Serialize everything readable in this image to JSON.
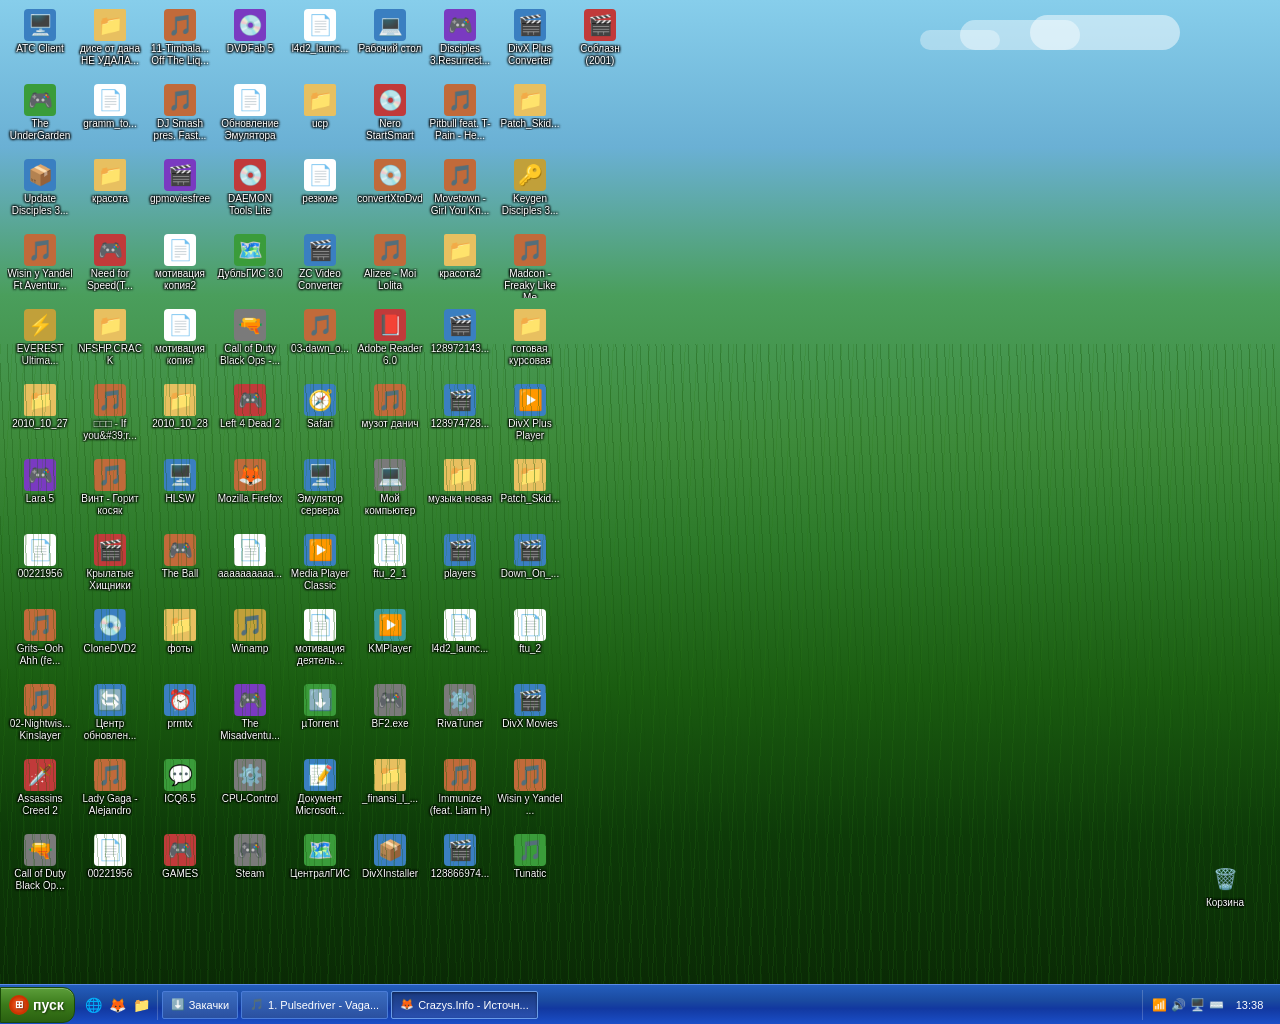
{
  "desktop": {
    "icons": [
      {
        "id": "atc-client",
        "label": "ATC Client",
        "emoji": "🖥️",
        "color": "ic-blue"
      },
      {
        "id": "undergarden",
        "label": "The UnderGarden",
        "emoji": "🎮",
        "color": "ic-green"
      },
      {
        "id": "update-disciples",
        "label": "Update Disciples 3...",
        "emoji": "📦",
        "color": "ic-blue"
      },
      {
        "id": "wisin-yandel",
        "label": "Wisin y Yandel Ft Aventur...",
        "emoji": "🎵",
        "color": "ic-orange"
      },
      {
        "id": "everest",
        "label": "EVEREST Ultima...",
        "emoji": "⚡",
        "color": "ic-yellow"
      },
      {
        "id": "2010-10-27",
        "label": "2010_10_27",
        "emoji": "📁",
        "color": "ic-folder"
      },
      {
        "id": "lara5",
        "label": "Lara 5",
        "emoji": "🎮",
        "color": "ic-purple"
      },
      {
        "id": "00221956-1",
        "label": "00221956",
        "emoji": "📄",
        "color": "ic-white"
      },
      {
        "id": "grits",
        "label": "Grits--Ooh Ahh (fe...",
        "emoji": "🎵",
        "color": "ic-orange"
      },
      {
        "id": "02-nightwish",
        "label": "02-Nightwis... Kinslayer",
        "emoji": "🎵",
        "color": "ic-orange"
      },
      {
        "id": "assassins-creed",
        "label": "Assassins Creed 2",
        "emoji": "🗡️",
        "color": "ic-red"
      },
      {
        "id": "call-of-duty-1",
        "label": "Call of Duty Black Op...",
        "emoji": "🔫",
        "color": "ic-gray"
      },
      {
        "id": "dise-ot-dana",
        "label": "дисе от дана НЕ УДАЛА...",
        "emoji": "📁",
        "color": "ic-folder"
      },
      {
        "id": "gramm-to",
        "label": "gramm_to...",
        "emoji": "📄",
        "color": "ic-white"
      },
      {
        "id": "krasota1",
        "label": "красота",
        "emoji": "📁",
        "color": "ic-folder"
      },
      {
        "id": "need-for-speed",
        "label": "Need for Speed(T...",
        "emoji": "🎮",
        "color": "ic-red"
      },
      {
        "id": "nfshp-crack",
        "label": "NFSHP.CRACK",
        "emoji": "📁",
        "color": "ic-folder"
      },
      {
        "id": "square-you",
        "label": "□□□ - If you&#39;r...",
        "emoji": "🎵",
        "color": "ic-orange"
      },
      {
        "id": "vint",
        "label": "Винт - Горит косяк",
        "emoji": "🎵",
        "color": "ic-orange"
      },
      {
        "id": "krylatye",
        "label": "Крылатые Хищники",
        "emoji": "🎬",
        "color": "ic-red"
      },
      {
        "id": "clonedvd2",
        "label": "CloneDVD2",
        "emoji": "💿",
        "color": "ic-blue"
      },
      {
        "id": "centr-obnovl",
        "label": "Центр обновлен...",
        "emoji": "🔄",
        "color": "ic-blue"
      },
      {
        "id": "lady-gaga",
        "label": "Lady Gaga - Alejandro",
        "emoji": "🎵",
        "color": "ic-orange"
      },
      {
        "id": "00221956-2",
        "label": "00221956",
        "emoji": "📄",
        "color": "ic-white"
      },
      {
        "id": "11-timbalake",
        "label": "11-Timbala... Off The Liq...",
        "emoji": "🎵",
        "color": "ic-orange"
      },
      {
        "id": "dj-smash",
        "label": "DJ Smash pres. Fast...",
        "emoji": "🎵",
        "color": "ic-orange"
      },
      {
        "id": "gpmoviesfree",
        "label": "gpmoviesfree",
        "emoji": "🎬",
        "color": "ic-purple"
      },
      {
        "id": "motivatsiya-kopia2",
        "label": "мотивация копия2",
        "emoji": "📄",
        "color": "ic-white"
      },
      {
        "id": "motivatsiya-kopia",
        "label": "мотивация копия",
        "emoji": "📄",
        "color": "ic-white"
      },
      {
        "id": "2010-10-27b",
        "label": "2010_10_28",
        "emoji": "📁",
        "color": "ic-folder"
      },
      {
        "id": "hlsw",
        "label": "HLSW",
        "emoji": "🖥️",
        "color": "ic-blue"
      },
      {
        "id": "the-ball",
        "label": "The Ball",
        "emoji": "🎮",
        "color": "ic-orange"
      },
      {
        "id": "foty",
        "label": "фоты",
        "emoji": "📁",
        "color": "ic-folder"
      },
      {
        "id": "prmtx",
        "label": "prmtx",
        "emoji": "⏰",
        "color": "ic-blue"
      },
      {
        "id": "icq65",
        "label": "ICQ6.5",
        "emoji": "💬",
        "color": "ic-green"
      },
      {
        "id": "games",
        "label": "GAMES",
        "emoji": "🎮",
        "color": "ic-red"
      },
      {
        "id": "dvdfab5",
        "label": "DVDFab 5",
        "emoji": "💿",
        "color": "ic-purple"
      },
      {
        "id": "obnovlenie",
        "label": "Обновление Эмулятора",
        "emoji": "📄",
        "color": "ic-white"
      },
      {
        "id": "daemon-tools",
        "label": "DAEMON Tools Lite",
        "emoji": "💿",
        "color": "ic-red"
      },
      {
        "id": "dubIgis",
        "label": "ДубльГИС 3.0",
        "emoji": "🗺️",
        "color": "ic-green"
      },
      {
        "id": "call-of-duty-2",
        "label": "Call of Duty Black Ops -...",
        "emoji": "🔫",
        "color": "ic-gray"
      },
      {
        "id": "left4dead2",
        "label": "Left 4 Dead 2",
        "emoji": "🎮",
        "color": "ic-red"
      },
      {
        "id": "mozilla-firefox",
        "label": "Mozilla Firefox",
        "emoji": "🦊",
        "color": "ic-orange"
      },
      {
        "id": "aaaaa",
        "label": "аааааааааа...",
        "emoji": "📄",
        "color": "ic-white"
      },
      {
        "id": "winamp",
        "label": "Winamp",
        "emoji": "🎵",
        "color": "ic-yellow"
      },
      {
        "id": "misadventu",
        "label": "The Misadventu...",
        "emoji": "🎮",
        "color": "ic-purple"
      },
      {
        "id": "cpu-control",
        "label": "CPU-Control",
        "emoji": "⚙️",
        "color": "ic-gray"
      },
      {
        "id": "steam",
        "label": "Steam",
        "emoji": "🎮",
        "color": "ic-gray"
      },
      {
        "id": "l4d2-launch",
        "label": "l4d2_launc...",
        "emoji": "📄",
        "color": "ic-white"
      },
      {
        "id": "ucp",
        "label": "ucp",
        "emoji": "📁",
        "color": "ic-folder"
      },
      {
        "id": "rezyume",
        "label": "резюме",
        "emoji": "📄",
        "color": "ic-white"
      },
      {
        "id": "zc-video",
        "label": "ZC Video Converter",
        "emoji": "🎬",
        "color": "ic-blue"
      },
      {
        "id": "03-dawn",
        "label": "03-dawn_o...",
        "emoji": "🎵",
        "color": "ic-orange"
      },
      {
        "id": "safari",
        "label": "Safari",
        "emoji": "🧭",
        "color": "ic-blue"
      },
      {
        "id": "emulator-servera",
        "label": "Эмулятор сервера",
        "emoji": "🖥️",
        "color": "ic-blue"
      },
      {
        "id": "media-player",
        "label": "Media Player Classic",
        "emoji": "▶️",
        "color": "ic-blue"
      },
      {
        "id": "motivatsiya-deyat",
        "label": "мотивация деятель...",
        "emoji": "📄",
        "color": "ic-white"
      },
      {
        "id": "utorrent",
        "label": "µTorrent",
        "emoji": "⬇️",
        "color": "ic-green"
      },
      {
        "id": "dokument",
        "label": "Документ Microsoft...",
        "emoji": "📝",
        "color": "ic-blue"
      },
      {
        "id": "centralgis",
        "label": "ЦентралГИС",
        "emoji": "🗺️",
        "color": "ic-green"
      },
      {
        "id": "rabochiy-stol",
        "label": "Рабочий стол",
        "emoji": "💻",
        "color": "ic-blue"
      },
      {
        "id": "nero",
        "label": "Nero StartSmart",
        "emoji": "💿",
        "color": "ic-red"
      },
      {
        "id": "convert-dvd",
        "label": "convertXtoDvd",
        "emoji": "💿",
        "color": "ic-orange"
      },
      {
        "id": "alizee",
        "label": "Alizee - Moi Lolita",
        "emoji": "🎵",
        "color": "ic-orange"
      },
      {
        "id": "adobe-reader",
        "label": "Adobe Reader 6.0",
        "emoji": "📕",
        "color": "ic-red"
      },
      {
        "id": "muzot-danicu",
        "label": "музот данич",
        "emoji": "🎵",
        "color": "ic-orange"
      },
      {
        "id": "moy-kompyuter",
        "label": "Мой компьютер",
        "emoji": "💻",
        "color": "ic-gray"
      },
      {
        "id": "ftu-2-1",
        "label": "ftu_2_1",
        "emoji": "📄",
        "color": "ic-white"
      },
      {
        "id": "kmplayer",
        "label": "KMPlayer",
        "emoji": "▶️",
        "color": "ic-teal"
      },
      {
        "id": "bf2exe",
        "label": "BF2.exe",
        "emoji": "🎮",
        "color": "ic-gray"
      },
      {
        "id": "finansi",
        "label": "_finansi_l_...",
        "emoji": "📁",
        "color": "ic-folder"
      },
      {
        "id": "divx-installer",
        "label": "DivXInstaller",
        "emoji": "📦",
        "color": "ic-blue"
      },
      {
        "id": "disciples3",
        "label": "Disciples 3.Resurrect...",
        "emoji": "🎮",
        "color": "ic-purple"
      },
      {
        "id": "pitbull",
        "label": "Pitbull feat. T-Pain - He...",
        "emoji": "🎵",
        "color": "ic-orange"
      },
      {
        "id": "movetown",
        "label": "Movetown - Girl You Kn...",
        "emoji": "🎵",
        "color": "ic-orange"
      },
      {
        "id": "krasota2",
        "label": "красота2",
        "emoji": "📁",
        "color": "ic-folder"
      },
      {
        "id": "128972143",
        "label": "128972143...",
        "emoji": "🎬",
        "color": "ic-blue"
      },
      {
        "id": "128974728",
        "label": "128974728...",
        "emoji": "🎬",
        "color": "ic-blue"
      },
      {
        "id": "muzyka-novaya",
        "label": "музыка новая",
        "emoji": "📁",
        "color": "ic-folder"
      },
      {
        "id": "players",
        "label": "players",
        "emoji": "🎬",
        "color": "ic-blue"
      },
      {
        "id": "l4d2-launch2",
        "label": "l4d2_launc...",
        "emoji": "📄",
        "color": "ic-white"
      },
      {
        "id": "rivatuner",
        "label": "RivaTuner",
        "emoji": "⚙️",
        "color": "ic-gray"
      },
      {
        "id": "immunize",
        "label": "Immunize (feat. Liam H)",
        "emoji": "🎵",
        "color": "ic-orange"
      },
      {
        "id": "128866974",
        "label": "128866974...",
        "emoji": "🎬",
        "color": "ic-blue"
      },
      {
        "id": "divx-plus-converter",
        "label": "DivX Plus Converter",
        "emoji": "🎬",
        "color": "ic-blue"
      },
      {
        "id": "patch-skid1",
        "label": "Patch_Skid...",
        "emoji": "📁",
        "color": "ic-folder"
      },
      {
        "id": "keygen",
        "label": "Keygen Disciples 3...",
        "emoji": "🔑",
        "color": "ic-yellow"
      },
      {
        "id": "madcon",
        "label": "Madcon - Freaky Like Me",
        "emoji": "🎵",
        "color": "ic-orange"
      },
      {
        "id": "gotovaya",
        "label": "готовая курсовая",
        "emoji": "📁",
        "color": "ic-folder"
      },
      {
        "id": "divx-plus-player",
        "label": "DivX Plus Player",
        "emoji": "▶️",
        "color": "ic-blue"
      },
      {
        "id": "patch-skid2",
        "label": "Patch_Skid...",
        "emoji": "📁",
        "color": "ic-folder"
      },
      {
        "id": "down-on",
        "label": "Down_On_...",
        "emoji": "🎬",
        "color": "ic-blue"
      },
      {
        "id": "ftu2",
        "label": "ftu_2",
        "emoji": "📄",
        "color": "ic-white"
      },
      {
        "id": "divx-movies",
        "label": "DivX Movies",
        "emoji": "🎬",
        "color": "ic-blue"
      },
      {
        "id": "wisin-yandel2",
        "label": "Wisin y Yandel ...",
        "emoji": "🎵",
        "color": "ic-orange"
      },
      {
        "id": "tunatic",
        "label": "Tunatic",
        "emoji": "🎵",
        "color": "ic-green"
      },
      {
        "id": "soblazn",
        "label": "Соблазн (2001)",
        "emoji": "🎬",
        "color": "ic-red"
      }
    ]
  },
  "recycle_bin": {
    "label": "Корзина",
    "emoji": "🗑️"
  },
  "taskbar": {
    "start_label": "пуск",
    "quick_launch": [
      {
        "id": "ql-ie",
        "emoji": "🌐",
        "title": "Internet Explorer"
      },
      {
        "id": "ql-firefox",
        "emoji": "🦊",
        "title": "Firefox"
      },
      {
        "id": "ql-folder",
        "emoji": "📁",
        "title": "Folder"
      }
    ],
    "items": [
      {
        "id": "task-zakachki",
        "label": "Закачки",
        "emoji": "⬇️",
        "active": false
      },
      {
        "id": "task-pulsedriver",
        "label": "1. Pulsedriver - Vaga...",
        "emoji": "🎵",
        "active": false
      },
      {
        "id": "task-crazys",
        "label": "Crazys.Info - Источн...",
        "emoji": "🦊",
        "active": true
      }
    ],
    "tray": {
      "icons": [
        "📶",
        "🔊",
        "🖥️",
        "⌨️"
      ],
      "time": "13:38",
      "date": "13:38"
    }
  }
}
